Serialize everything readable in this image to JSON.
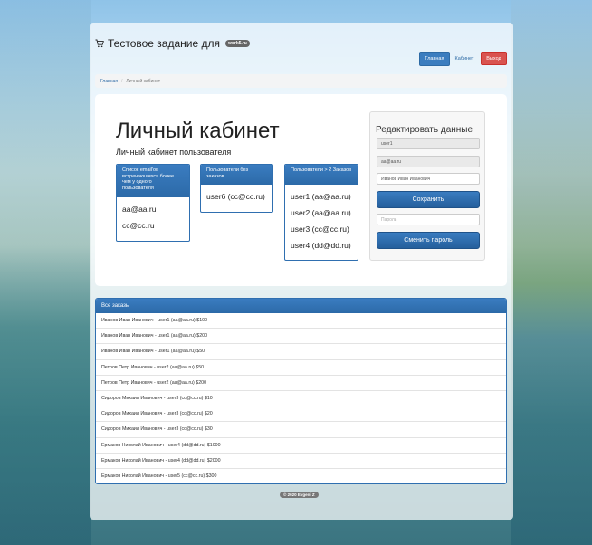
{
  "header": {
    "title": "Тестовое задание для",
    "badge": "work5.ru",
    "nav": {
      "home": "Главная",
      "cabinet": "Кабинет",
      "logout": "Выход"
    }
  },
  "breadcrumb": {
    "home": "Главная",
    "current": "Личный кабинет"
  },
  "main": {
    "title": "Личный кабинет",
    "subtitle": "Личный кабинет пользователя",
    "panels": [
      {
        "title": "Список email'ов встречающихся более чем у одного пользователя",
        "items": [
          "aa@aa.ru",
          "cc@cc.ru"
        ]
      },
      {
        "title": "Пользователи без заказов",
        "items": [
          "user6 (cc@cc.ru)"
        ]
      },
      {
        "title": "Пользователи > 2 Заказов",
        "items": [
          "user1 (aa@aa.ru)",
          "user2 (aa@aa.ru)",
          "user3 (cc@cc.ru)",
          "user4 (dd@dd.ru)"
        ]
      }
    ]
  },
  "edit": {
    "title": "Редактировать данные",
    "login_value": "user1",
    "email_value": "aa@aa.ru",
    "name_value": "Иванов Иван Иванович",
    "save_label": "Сохранить",
    "password_placeholder": "Пароль",
    "change_password_label": "Сменить пароль"
  },
  "orders": {
    "title": "Все заказы",
    "rows": [
      "Иванов Иван Иванович - user1 (aa@aa.ru) $100",
      "Иванов Иван Иванович - user1 (aa@aa.ru) $200",
      "Иванов Иван Иванович - user1 (aa@aa.ru) $50",
      "Петров Петр Иванович - user2 (aa@aa.ru) $50",
      "Петров Петр Иванович - user2 (aa@aa.ru) $200",
      "Сидоров Михаил Иванович - user3 (cc@cc.ru) $10",
      "Сидоров Михаил Иванович - user3 (cc@cc.ru) $20",
      "Сидоров Михаил Иванович - user3 (cc@cc.ru) $30",
      "Ермаков Николай Иванович - user4 (dd@dd.ru) $1000",
      "Ермаков Николай Иванович - user4 (dd@dd.ru) $2000",
      "Ермаков Николай Иванович - user5 (cc@cc.ru) $300"
    ]
  },
  "footer": {
    "text": "© 2020 Evgeni Z"
  },
  "colors": {
    "primary": "#2c6aa8",
    "danger": "#d9534f"
  },
  "icons": {
    "brand": "cart-icon"
  }
}
